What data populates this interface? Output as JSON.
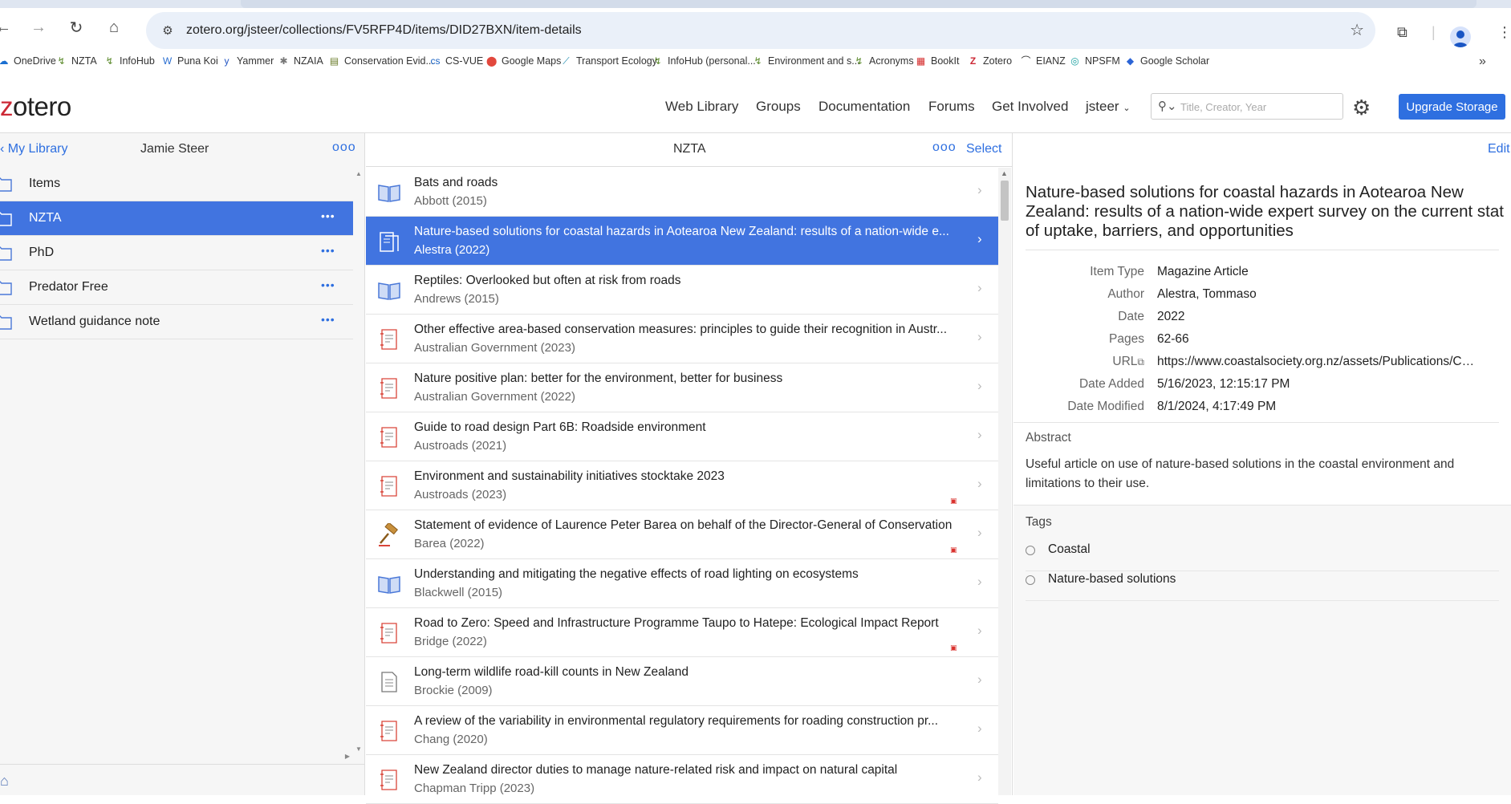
{
  "browser": {
    "url": "zotero.org/jsteer/collections/FV5RFP4D/items/DID27BXN/item-details",
    "bookmarks": [
      {
        "label": "OneDrive",
        "icon": "cloud-icon"
      },
      {
        "label": "NZTA",
        "icon": "nzta-icon"
      },
      {
        "label": "InfoHub",
        "icon": "nzta-icon"
      },
      {
        "label": "Puna Koi",
        "icon": "wiki-icon"
      },
      {
        "label": "Yammer",
        "icon": "yammer-icon"
      },
      {
        "label": "NZAIA",
        "icon": "nzaia-icon"
      },
      {
        "label": "Conservation Evid...",
        "icon": "book-icon"
      },
      {
        "label": "CS-VUE",
        "icon": "csvue-icon"
      },
      {
        "label": "Google Maps",
        "icon": "map-pin-icon"
      },
      {
        "label": "Transport Ecology",
        "icon": "leaf-icon"
      },
      {
        "label": "InfoHub (personal...",
        "icon": "nzta-icon"
      },
      {
        "label": "Environment and s...",
        "icon": "nzta-icon"
      },
      {
        "label": "Acronyms",
        "icon": "nzta-icon"
      },
      {
        "label": "BookIt",
        "icon": "calendar-icon"
      },
      {
        "label": "Zotero",
        "icon": "zotero-icon"
      },
      {
        "label": "EIANZ",
        "icon": "eianz-icon"
      },
      {
        "label": "NPSFM",
        "icon": "npsfm-icon"
      },
      {
        "label": "Google Scholar",
        "icon": "scholar-icon"
      }
    ],
    "bookmark_more": "»"
  },
  "header": {
    "logo_z": "z",
    "logo_rest": "otero",
    "nav": [
      "Web Library",
      "Groups",
      "Documentation",
      "Forums",
      "Get Involved"
    ],
    "user": "jsteer",
    "search_placeholder": "Title, Creator, Year",
    "upgrade": "Upgrade Storage"
  },
  "left": {
    "back": "My Library",
    "owner": "Jamie Steer",
    "collections": [
      {
        "label": "Items",
        "selected": false,
        "dots": ""
      },
      {
        "label": "NZTA",
        "selected": true,
        "dots": "•••"
      },
      {
        "label": "PhD",
        "selected": false,
        "dots": "•••"
      },
      {
        "label": "Predator Free",
        "selected": false,
        "dots": "•••"
      },
      {
        "label": "Wetland guidance note",
        "selected": false,
        "dots": "•••"
      }
    ]
  },
  "middle": {
    "title": "NZTA",
    "select": "Select",
    "items": [
      {
        "title": "Bats and roads",
        "creator": "Abbott (2015)",
        "type": "book",
        "pdf": false,
        "selected": false
      },
      {
        "title": "Nature-based solutions for coastal hazards in Aotearoa New Zealand: results of a nation-wide e...",
        "creator": "Alestra (2022)",
        "type": "magazine",
        "pdf": false,
        "selected": true
      },
      {
        "title": "Reptiles: Overlooked but often at risk from roads",
        "creator": "Andrews (2015)",
        "type": "book",
        "pdf": false,
        "selected": false
      },
      {
        "title": "Other effective area-based conservation measures: principles to guide their recognition in Austr...",
        "creator": "Australian Government (2023)",
        "type": "report",
        "pdf": false,
        "selected": false
      },
      {
        "title": "Nature positive plan: better for the environment, better for business",
        "creator": "Australian Government (2022)",
        "type": "report",
        "pdf": false,
        "selected": false
      },
      {
        "title": "Guide to road design Part 6B: Roadside environment",
        "creator": "Austroads (2021)",
        "type": "report",
        "pdf": false,
        "selected": false
      },
      {
        "title": "Environment and sustainability initiatives stocktake 2023",
        "creator": "Austroads (2023)",
        "type": "report",
        "pdf": true,
        "selected": false
      },
      {
        "title": "Statement of evidence of Laurence Peter Barea on behalf of the Director-General of Conservation",
        "creator": "Barea (2022)",
        "type": "hearing",
        "pdf": true,
        "selected": false
      },
      {
        "title": "Understanding and mitigating the negative effects of road lighting on ecosystems",
        "creator": "Blackwell (2015)",
        "type": "book",
        "pdf": false,
        "selected": false
      },
      {
        "title": "Road to Zero: Speed and Infrastructure Programme Taupo to Hatepe: Ecological Impact Report",
        "creator": "Bridge (2022)",
        "type": "report",
        "pdf": true,
        "selected": false
      },
      {
        "title": "Long-term wildlife road-kill counts in New Zealand",
        "creator": "Brockie (2009)",
        "type": "document",
        "pdf": false,
        "selected": false
      },
      {
        "title": "A review of the variability in environmental regulatory requirements for roading construction pr...",
        "creator": "Chang (2020)",
        "type": "report",
        "pdf": false,
        "selected": false
      },
      {
        "title": "New Zealand director duties to manage nature-related risk and impact on natural capital",
        "creator": "Chapman Tripp (2023)",
        "type": "report",
        "pdf": false,
        "selected": false
      }
    ]
  },
  "right": {
    "edit": "Edit",
    "title": "Nature-based solutions for coastal hazards in Aotearoa New Zealand: results of a nation-wide expert survey on the current stat of uptake, barriers, and opportunities",
    "fields": [
      {
        "key": "Item Type",
        "value": "Magazine Article"
      },
      {
        "key": "Author",
        "value": "Alestra, Tommaso"
      },
      {
        "key": "Date",
        "value": "2022"
      },
      {
        "key": "Pages",
        "value": "62-66"
      },
      {
        "key": "URL",
        "value": "https://www.coastalsociety.org.nz/assets/Publications/Coastal-News/..."
      },
      {
        "key": "Date Added",
        "value": "5/16/2023, 12:15:17 PM"
      },
      {
        "key": "Date Modified",
        "value": "8/1/2024, 4:17:49 PM"
      }
    ],
    "abstract_heading": "Abstract",
    "abstract": "Useful article on use of nature-based solutions in the coastal environment and limitations to their use.",
    "tags_heading": "Tags",
    "tags": [
      "Coastal",
      "Nature-based solutions"
    ]
  },
  "colors": {
    "accent": "#4174e0",
    "link": "#2e6fe0",
    "zotero_red": "#cc2936",
    "pdf_red": "#d9312d"
  }
}
